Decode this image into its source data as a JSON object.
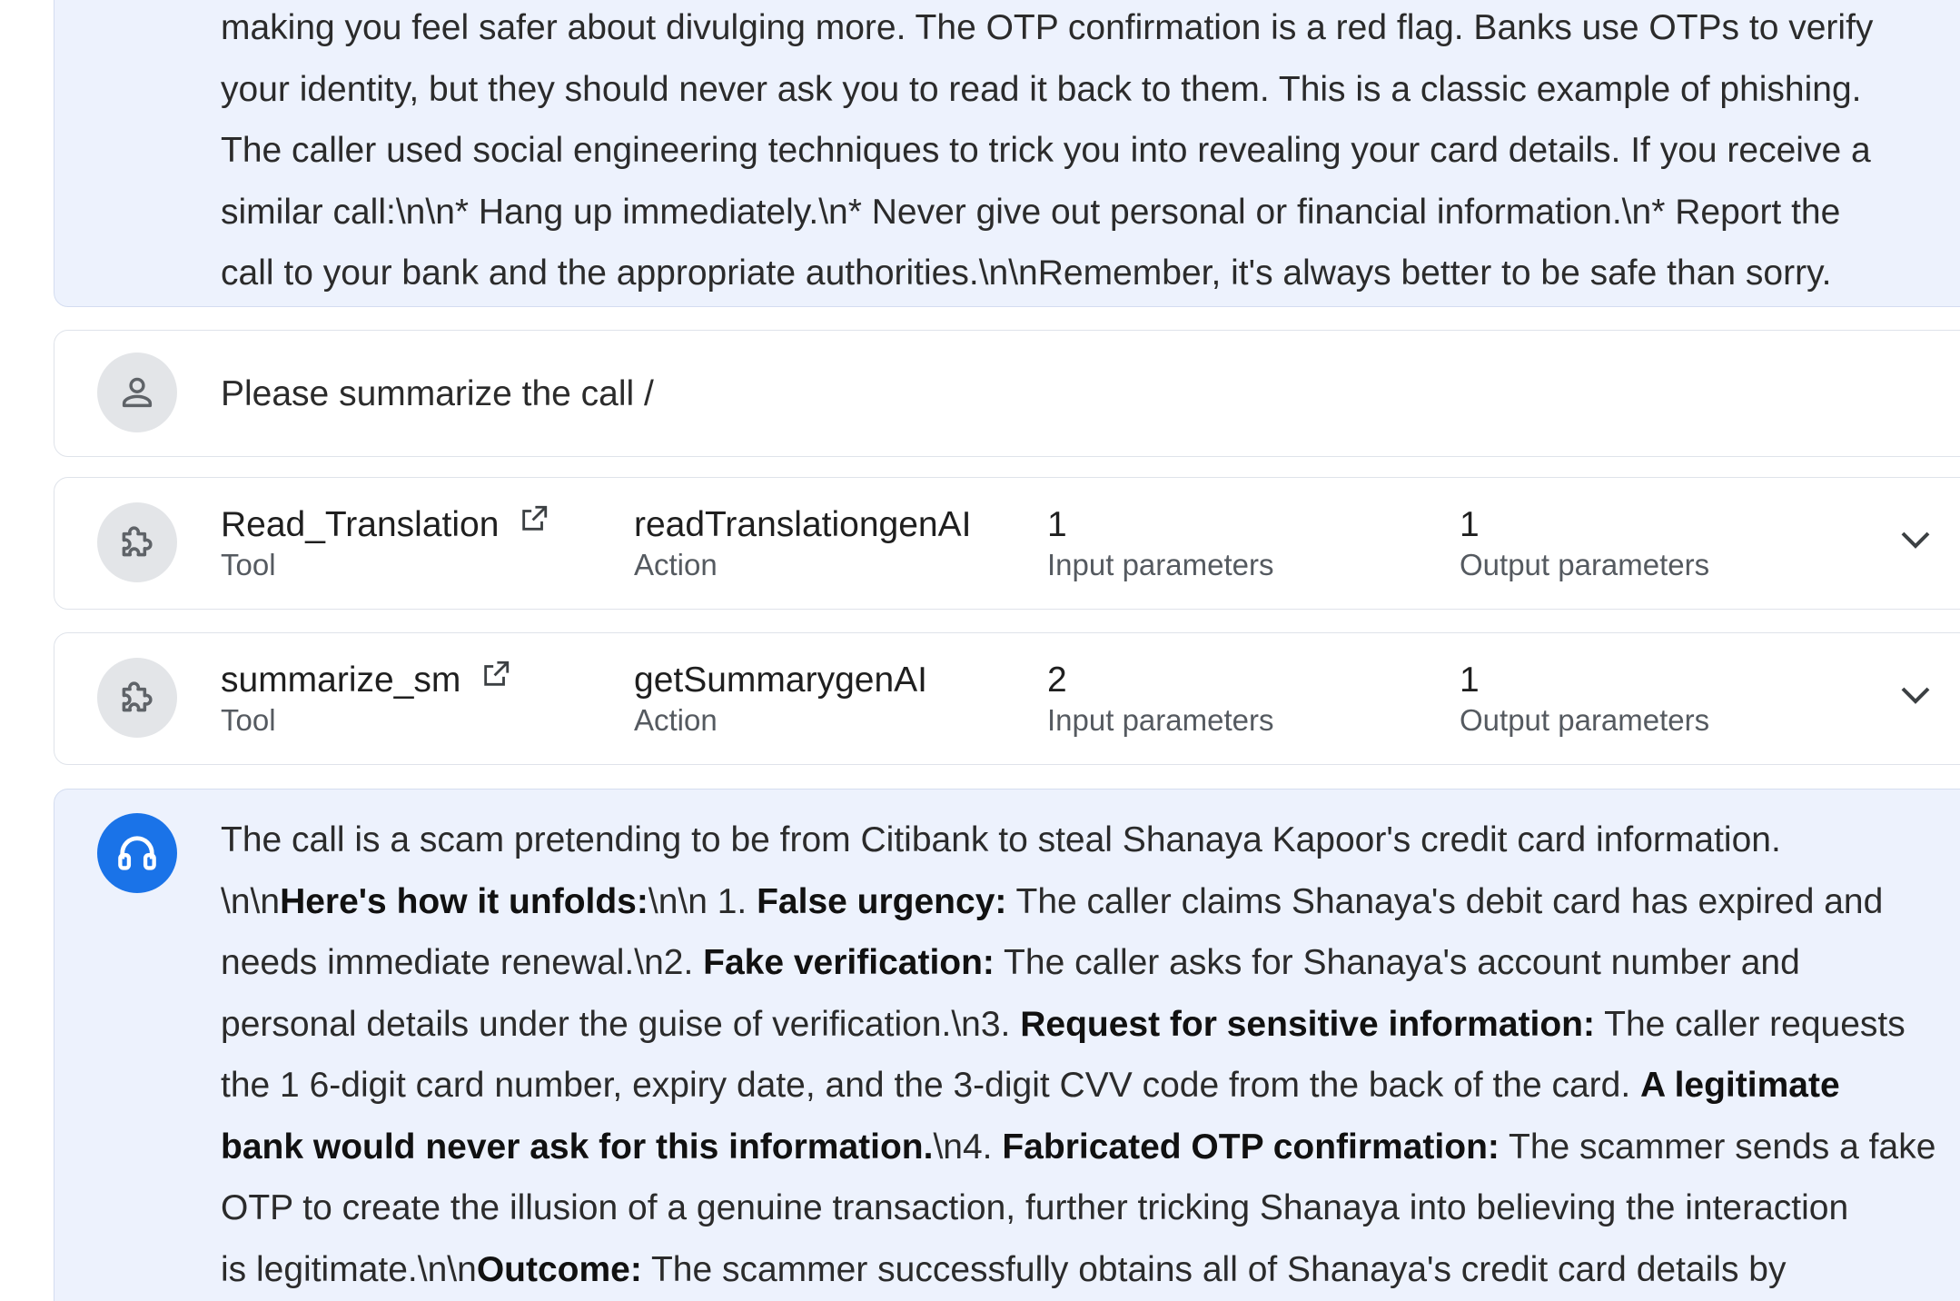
{
  "messages": {
    "agent_reply_1": {
      "icon": "headset-icon",
      "lines": [
        "making you feel safer about divulging more. The OTP confirmation is a red flag. Banks use OTPs to verify",
        "your identity, but they should never ask you to read it back to them. This is a classic example of phishing.",
        "The caller used social engineering techniques to trick you into revealing your card details. If you receive a",
        "similar call:\\n\\n* Hang up immediately.\\n* Never give out personal or financial information.\\n* Report the",
        "call to your bank and the appropriate authorities.\\n\\nRemember, it's always better to be safe than sorry."
      ]
    },
    "user_prompt": {
      "icon": "person-icon",
      "text": "Please summarize the call /"
    },
    "agent_reply_2": {
      "icon": "headset-icon",
      "l1": "The call is a scam pretending to be from Citibank to steal Shanaya Kapoor's credit card information.",
      "l2_a": "\\n\\n",
      "l2_b": "Here's how it unfolds:",
      "l2_c": "\\n\\n 1. ",
      "l2_d": "False urgency:",
      "l2_e": " The caller claims Shanaya's debit card has expired and",
      "l3_a": "needs immediate renewal.\\n2. ",
      "l3_b": "Fake verification:",
      "l3_c": " The caller asks for Shanaya's account number and",
      "l4_a": "personal details under the guise of verification.\\n3. ",
      "l4_b": "Request for sensitive information:",
      "l4_c": " The caller requests",
      "l5_a": "the 1 6-digit card number, expiry date, and the 3-digit CVV code from the back of the card. ",
      "l5_b": "A legitimate",
      "l6_a": "bank would never ask for this information.",
      "l6_b": "\\n4. ",
      "l6_c": "Fabricated OTP confirmation:",
      "l6_d": " The scammer sends a fake",
      "l7": "OTP to create the illusion of a genuine transaction, further tricking Shanaya into believing the interaction",
      "l8_a": "is legitimate.\\n\\n",
      "l8_b": "Outcome:",
      "l8_c": " The scammer successfully obtains all of Shanaya's credit card details by"
    }
  },
  "tools": [
    {
      "name": "Read_Translation",
      "type_label": "Tool",
      "action": "readTranslationgenAI",
      "action_label": "Action",
      "inputs": "1",
      "inputs_label": "Input parameters",
      "outputs": "1",
      "outputs_label": "Output parameters",
      "icon": "puzzle-icon"
    },
    {
      "name": "summarize_sm",
      "type_label": "Tool",
      "action": "getSummarygenAI",
      "action_label": "Action",
      "inputs": "2",
      "inputs_label": "Input parameters",
      "outputs": "1",
      "outputs_label": "Output parameters",
      "icon": "puzzle-icon"
    }
  ]
}
